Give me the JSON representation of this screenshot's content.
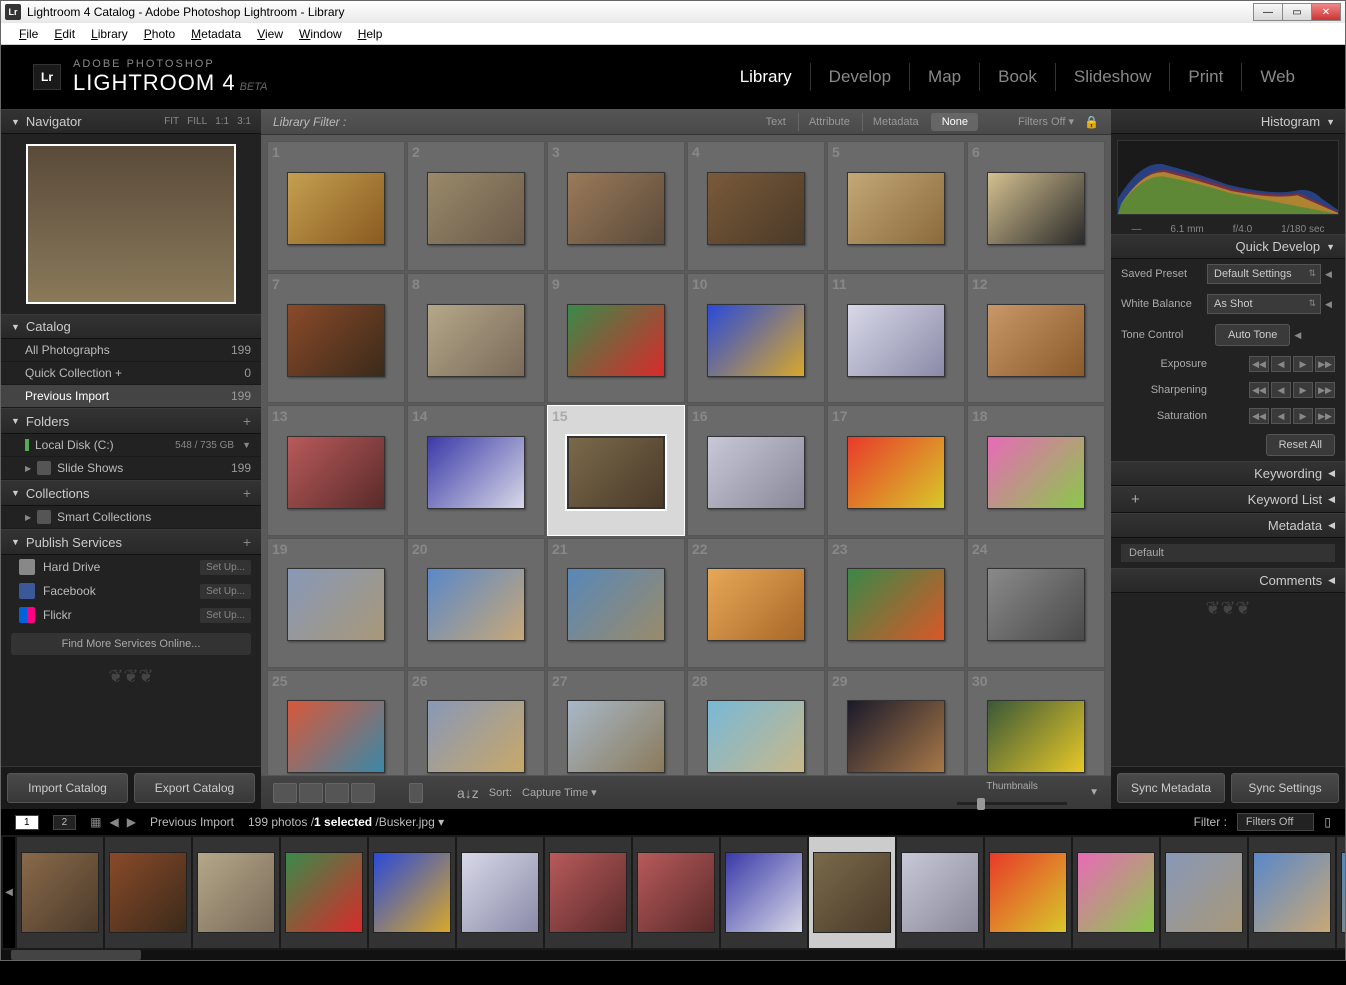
{
  "titlebar": {
    "text": "Lightroom 4 Catalog - Adobe Photoshop Lightroom - Library"
  },
  "menubar": [
    "File",
    "Edit",
    "Library",
    "Photo",
    "Metadata",
    "View",
    "Window",
    "Help"
  ],
  "branding": {
    "line1": "ADOBE PHOTOSHOP",
    "line2": "LIGHTROOM 4",
    "beta": "BETA",
    "logo": "Lr"
  },
  "modules": [
    "Library",
    "Develop",
    "Map",
    "Book",
    "Slideshow",
    "Print",
    "Web"
  ],
  "active_module": "Library",
  "left": {
    "navigator": {
      "title": "Navigator",
      "opts": [
        "FIT",
        "FILL",
        "1:1",
        "3:1"
      ]
    },
    "catalog": {
      "title": "Catalog",
      "items": [
        {
          "label": "All Photographs",
          "count": 199
        },
        {
          "label": "Quick Collection  +",
          "count": 0
        },
        {
          "label": "Previous Import",
          "count": 199,
          "selected": true
        }
      ]
    },
    "folders": {
      "title": "Folders",
      "disk_label": "Local Disk (C:)",
      "disk_size": "548 / 735 GB",
      "items": [
        {
          "label": "Slide Shows",
          "count": 199
        }
      ]
    },
    "collections": {
      "title": "Collections",
      "items": [
        {
          "label": "Smart Collections"
        }
      ]
    },
    "publish": {
      "title": "Publish Services",
      "setup": "Set Up...",
      "items": [
        {
          "label": "Hard Drive",
          "cls": "hd"
        },
        {
          "label": "Facebook",
          "cls": "fb"
        },
        {
          "label": "Flickr",
          "cls": "flickr"
        }
      ],
      "findmore": "Find More Services Online..."
    },
    "buttons": {
      "import": "Import Catalog",
      "export": "Export Catalog"
    }
  },
  "filterbar": {
    "title": "Library Filter :",
    "tabs": [
      "Text",
      "Attribute",
      "Metadata",
      "None"
    ],
    "active": "None",
    "filters_off": "Filters Off"
  },
  "grid": [
    {
      "n": 1,
      "c1": "#c4a050",
      "c2": "#8a5a20"
    },
    {
      "n": 2,
      "c1": "#9a8a6a",
      "c2": "#6a5a4a"
    },
    {
      "n": 3,
      "c1": "#9a7a5a",
      "c2": "#5a4a3a"
    },
    {
      "n": 4,
      "c1": "#7a5a3a",
      "c2": "#4a3a28"
    },
    {
      "n": 5,
      "c1": "#c4a878",
      "c2": "#8a6a3a"
    },
    {
      "n": 6,
      "c1": "#d4c090",
      "c2": "#2a2a2a"
    },
    {
      "n": 7,
      "c1": "#8a4a2a",
      "c2": "#3a2a1a"
    },
    {
      "n": 8,
      "c1": "#b4a888",
      "c2": "#7a6a5a"
    },
    {
      "n": 9,
      "c1": "#3a8a4a",
      "c2": "#d82a2a"
    },
    {
      "n": 10,
      "c1": "#2a4ad8",
      "c2": "#d8a82a"
    },
    {
      "n": 11,
      "c1": "#d8d8e8",
      "c2": "#8a8aa8"
    },
    {
      "n": 12,
      "c1": "#c89868",
      "c2": "#8a5a2a"
    },
    {
      "n": 13,
      "c1": "#b85a5a",
      "c2": "#5a2a2a"
    },
    {
      "n": 14,
      "c1": "#3a3aa8",
      "c2": "#d8d8e8"
    },
    {
      "n": 15,
      "c1": "#7a6a4a",
      "c2": "#4a3a2a",
      "sel": true
    },
    {
      "n": 16,
      "c1": "#c8c8d8",
      "c2": "#888898"
    },
    {
      "n": 17,
      "c1": "#e83a2a",
      "c2": "#d8c82a"
    },
    {
      "n": 18,
      "c1": "#e86ab8",
      "c2": "#8ac84a"
    },
    {
      "n": 19,
      "c1": "#8898b8",
      "c2": "#a89878"
    },
    {
      "n": 20,
      "c1": "#5a88c8",
      "c2": "#c8a878"
    },
    {
      "n": 21,
      "c1": "#5888b8",
      "c2": "#9a8a6a"
    },
    {
      "n": 22,
      "c1": "#e8a858",
      "c2": "#a86828"
    },
    {
      "n": 23,
      "c1": "#3a8848",
      "c2": "#d85828"
    },
    {
      "n": 24,
      "c1": "#8a8a8a",
      "c2": "#4a4a4a"
    },
    {
      "n": 25,
      "c1": "#d8583a",
      "c2": "#3a88a8"
    },
    {
      "n": 26,
      "c1": "#8898b8",
      "c2": "#c8a868"
    },
    {
      "n": 27,
      "c1": "#a8b8c8",
      "c2": "#8a7a5a"
    },
    {
      "n": 28,
      "c1": "#78b8d8",
      "c2": "#c8b888"
    },
    {
      "n": 29,
      "c1": "#1a1a2a",
      "c2": "#a87848"
    },
    {
      "n": 30,
      "c1": "#3a5838",
      "c2": "#e8c828"
    }
  ],
  "toolbar": {
    "sort_lbl": "Sort:",
    "sort_val": "Capture Time",
    "thumbs_lbl": "Thumbnails"
  },
  "statusbar": {
    "pages": [
      "1",
      "2"
    ],
    "bc": "Previous Import",
    "count": "199 photos",
    "sel": "1 selected",
    "file": "Busker.jpg",
    "filter_lbl": "Filter :",
    "filter_val": "Filters Off"
  },
  "filmstrip_colors": [
    [
      "#8a6a4a",
      "#4a3a2a"
    ],
    [
      "#8a4a2a",
      "#3a2a1a"
    ],
    [
      "#b4a888",
      "#7a6a5a"
    ],
    [
      "#3a8a4a",
      "#d82a2a"
    ],
    [
      "#2a4ad8",
      "#d8a82a"
    ],
    [
      "#d8d8e8",
      "#8a8aa8"
    ],
    [
      "#b85a5a",
      "#5a2a2a"
    ],
    [
      "#b85a5a",
      "#5a2a2a"
    ],
    [
      "#3a3aa8",
      "#d8d8e8"
    ],
    [
      "#7a6a4a",
      "#4a3a2a"
    ],
    [
      "#c8c8d8",
      "#888898"
    ],
    [
      "#e83a2a",
      "#d8c82a"
    ],
    [
      "#e86ab8",
      "#8ac84a"
    ],
    [
      "#8898b8",
      "#a89878"
    ],
    [
      "#5a88c8",
      "#c8a878"
    ],
    [
      "#5888b8",
      "#9a8a6a"
    ],
    [
      "#e8a858",
      "#a86828"
    ],
    [
      "#3a8848",
      "#d85828"
    ]
  ],
  "filmstrip_selected": 9,
  "right": {
    "histogram": {
      "title": "Histogram",
      "focal": "6.1 mm",
      "aperture": "f/4.0",
      "shutter": "1/180 sec",
      "dash": "—"
    },
    "quickdev": {
      "title": "Quick Develop",
      "preset_lbl": "Saved Preset",
      "preset_val": "Default Settings",
      "wb_lbl": "White Balance",
      "wb_val": "As Shot",
      "tone_lbl": "Tone Control",
      "tone_btn": "Auto Tone",
      "exposure": "Exposure",
      "sharpening": "Sharpening",
      "saturation": "Saturation",
      "reset": "Reset All"
    },
    "keywording": "Keywording",
    "keywordlist": "Keyword List",
    "metadata": {
      "title": "Metadata",
      "preset": "Default"
    },
    "comments": "Comments",
    "buttons": {
      "sync_meta": "Sync Metadata",
      "sync_set": "Sync Settings"
    }
  }
}
